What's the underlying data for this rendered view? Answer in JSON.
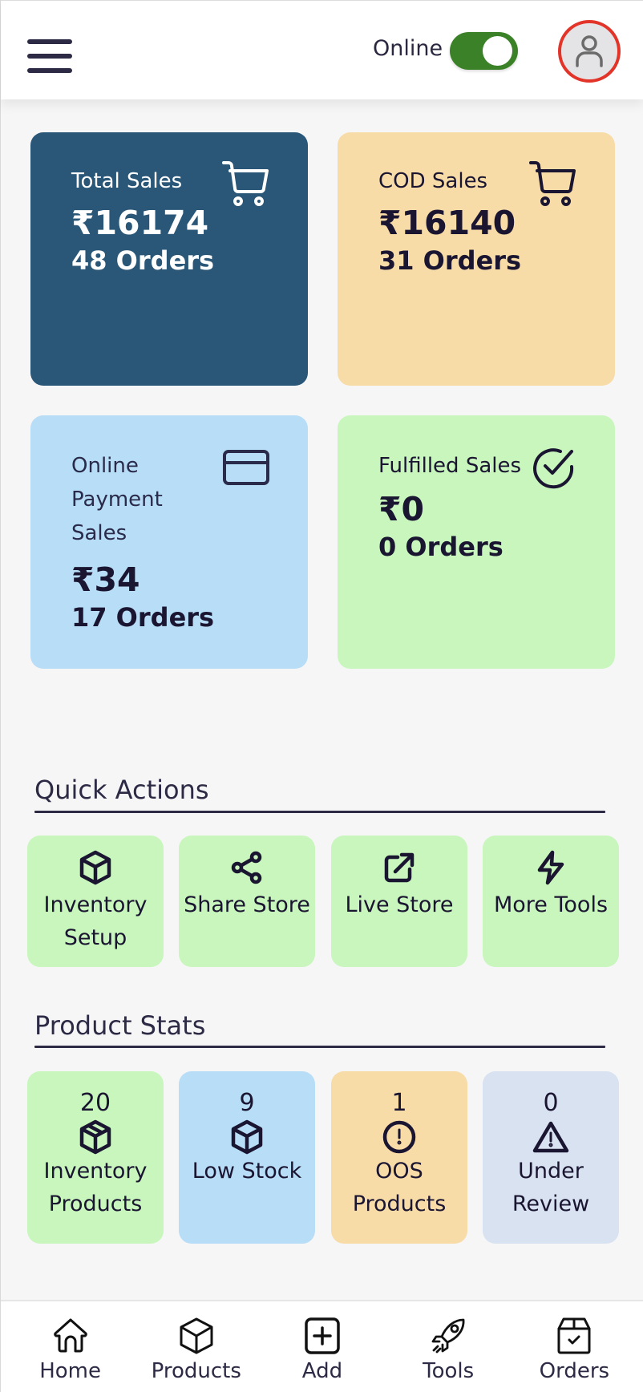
{
  "header": {
    "menu_icon": "hamburger-menu-icon",
    "online_label": "Online",
    "online_toggle_on": true,
    "avatar_icon": "user-icon",
    "colors": {
      "toggle": "#3b8128",
      "avatar_ring": "#e3342a"
    }
  },
  "cards": [
    {
      "title": "Total Sales",
      "amount": "₹16174",
      "orders": "48 Orders",
      "icon": "cart-icon",
      "color": "#2a5677"
    },
    {
      "title": "COD Sales",
      "amount": "₹16140",
      "orders": "31 Orders",
      "icon": "cart-icon",
      "color": "#f8dca8"
    },
    {
      "title": "Online Payment Sales",
      "amount": "₹34",
      "orders": "17 Orders",
      "icon": "credit-card-icon",
      "color": "#b8ddf7"
    },
    {
      "title": "Fulfilled Sales",
      "amount": "₹0",
      "orders": "0 Orders",
      "icon": "check-circle-icon",
      "color": "#c8f6bd"
    }
  ],
  "quick_actions": {
    "title": "Quick Actions",
    "items": [
      {
        "label": "Inventory Setup",
        "icon": "box-icon"
      },
      {
        "label": "Share Store",
        "icon": "share-icon"
      },
      {
        "label": "Live Store",
        "icon": "external-link-icon"
      },
      {
        "label": "More Tools",
        "icon": "lightning-icon"
      }
    ]
  },
  "product_stats": {
    "title": "Product Stats",
    "items": [
      {
        "count": "20",
        "label": "Inventory Products",
        "icon": "package-icon",
        "color": "#c8f6bd"
      },
      {
        "count": "9",
        "label": "Low Stock",
        "icon": "box-icon",
        "color": "#b8ddf7"
      },
      {
        "count": "1",
        "label": "OOS Products",
        "icon": "alert-circle-icon",
        "color": "#f8dca8"
      },
      {
        "count": "0",
        "label": "Under Review",
        "icon": "warning-triangle-icon",
        "color": "#d8e2f1"
      }
    ]
  },
  "bottom_nav": [
    {
      "label": "Home",
      "icon": "home-icon"
    },
    {
      "label": "Products",
      "icon": "cube-icon"
    },
    {
      "label": "Add",
      "icon": "plus-square-icon"
    },
    {
      "label": "Tools",
      "icon": "rocket-icon"
    },
    {
      "label": "Orders",
      "icon": "order-box-icon"
    }
  ]
}
